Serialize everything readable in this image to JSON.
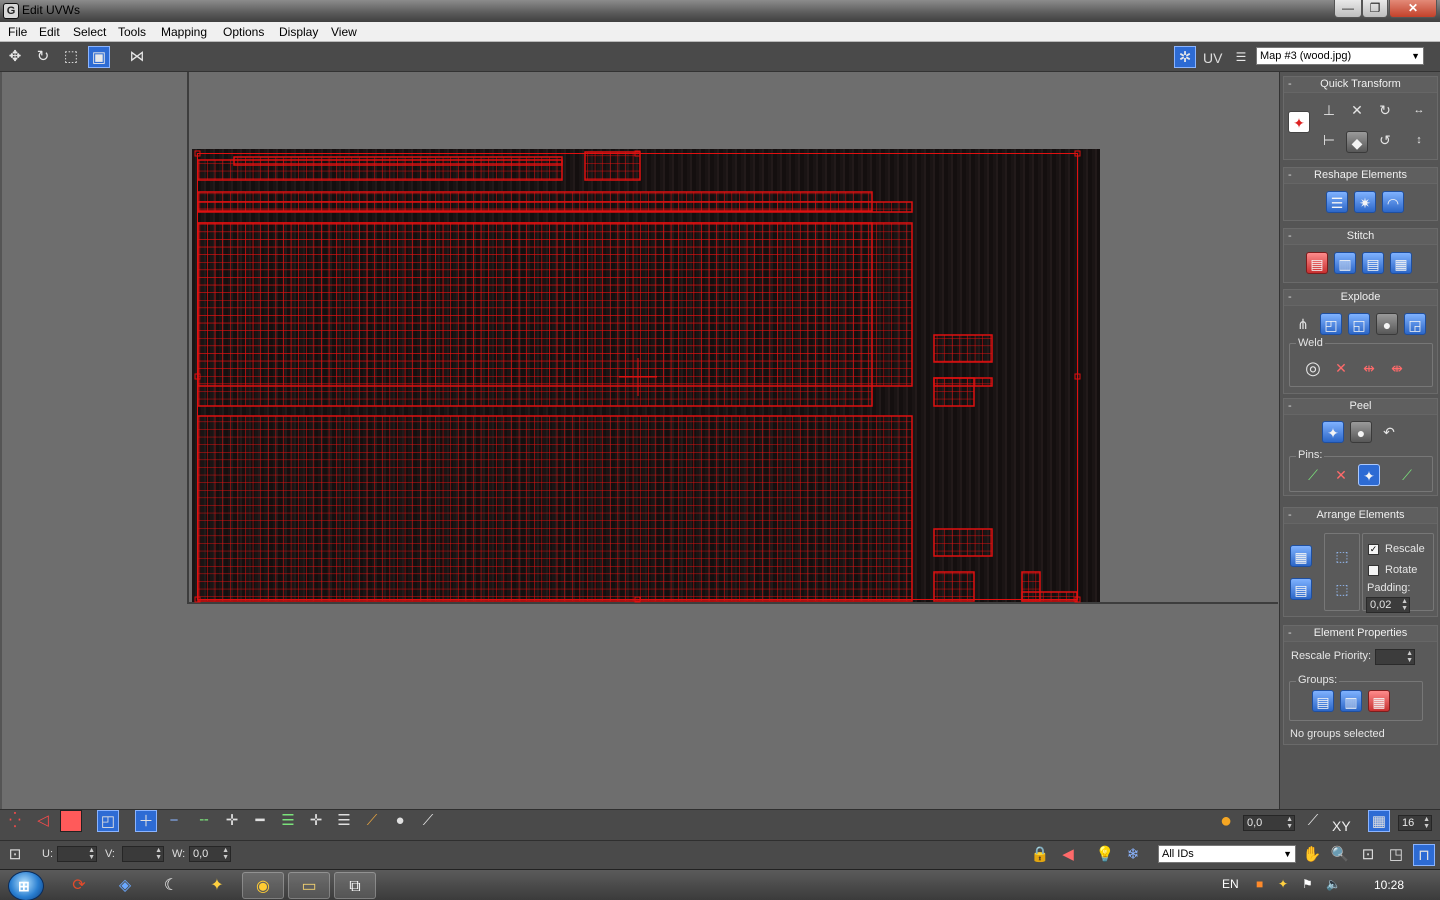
{
  "window": {
    "title": "Edit UVWs"
  },
  "titlebar": {
    "min": "—",
    "max": "❐",
    "close": "✕"
  },
  "menu": [
    "File",
    "Edit",
    "Select",
    "Tools",
    "Mapping",
    "Options",
    "Display",
    "View"
  ],
  "toolbar": {
    "uv_label": "UV",
    "map_selected": "Map #3 (wood.jpg)"
  },
  "panel": {
    "quick_transform": "Quick Transform",
    "reshape_elements": "Reshape Elements",
    "stitch": "Stitch",
    "explode": "Explode",
    "weld": "Weld",
    "peel": "Peel",
    "pins": "Pins:",
    "arrange_elements": "Arrange Elements",
    "rescale": "Rescale",
    "rescale_checked": true,
    "rotate": "Rotate",
    "rotate_checked": false,
    "padding_label": "Padding:",
    "padding_value": "0,02",
    "element_properties": "Element Properties",
    "rescale_priority": "Rescale Priority:",
    "groups": "Groups:",
    "groups_status": "No groups selected",
    "collapse": "-"
  },
  "bottom": {
    "u_label": "U:",
    "v_label": "V:",
    "w_label": "W:",
    "w_value": "0,0",
    "soft_value": "0,0",
    "xy_label": "XY",
    "grid_value": "16",
    "ids_selected": "All IDs"
  },
  "taskbar": {
    "lang": "EN",
    "time": "10:28"
  },
  "colors": {
    "uv_wire": "#e01010",
    "active_button": "#2d6bd4",
    "panel_bg": "#555555",
    "viewport_bg": "#6e6e6e"
  }
}
